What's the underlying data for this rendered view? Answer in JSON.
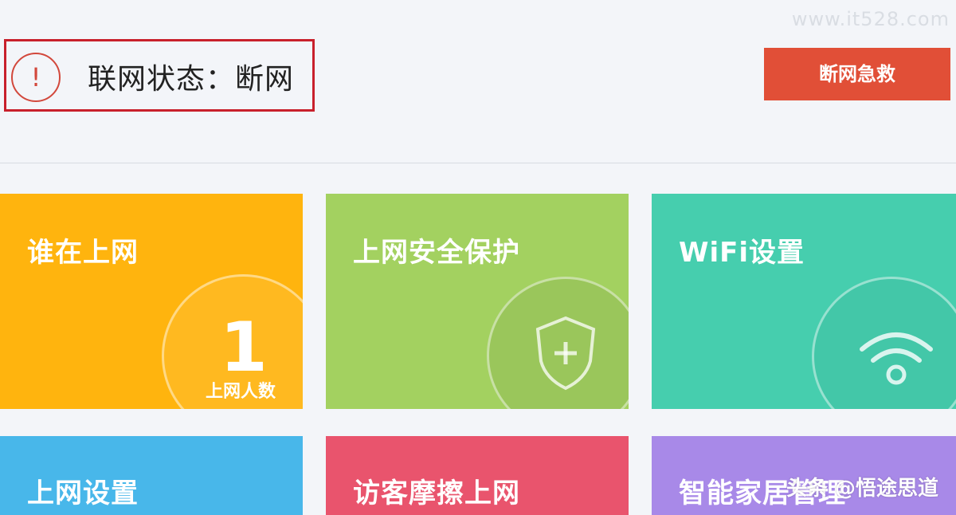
{
  "watermark": "www.it528.com",
  "status": {
    "alert_glyph": "!",
    "label": "联网状态：断网"
  },
  "rescue_button": {
    "label": "断网急救"
  },
  "tiles": [
    {
      "title": "谁在上网",
      "count": "1",
      "count_label": "上网人数",
      "color": "#ffb40e"
    },
    {
      "title": "上网安全保护",
      "icon": "shield-plus-icon",
      "color": "#a3d160"
    },
    {
      "title": "WiFi设置",
      "icon": "wifi-icon",
      "color": "#46ceae"
    },
    {
      "title": "上网设置",
      "color": "#48b7ea"
    },
    {
      "title": "访客摩擦上网",
      "color": "#e9546d"
    },
    {
      "title": "智能家居管理",
      "color": "#a889e8"
    }
  ],
  "overlay_watermark": "头条 @悟途思道"
}
